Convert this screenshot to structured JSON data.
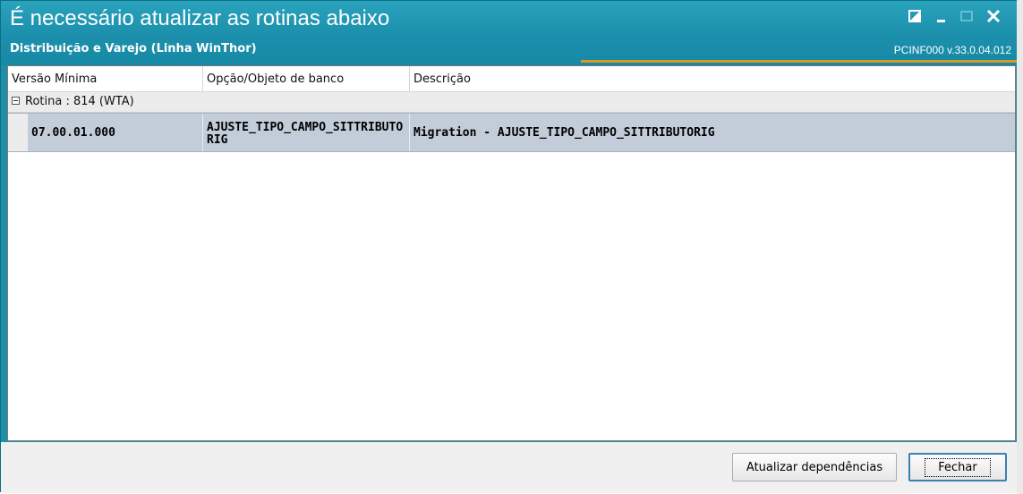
{
  "window": {
    "title": "É necessário atualizar as rotinas abaixo",
    "subtitle": "Distribuição e Varejo (Linha WinThor)",
    "version": "PCINF000  v.33.0.04.012",
    "accent": "#1b8fab",
    "underline_color": "#d49a2a"
  },
  "controls": {
    "restore_icon": "restore-icon",
    "minimize_icon": "minimize-icon",
    "maximize_icon": "maximize-icon",
    "close_icon": "close-icon"
  },
  "grid": {
    "columns": [
      "Versão Mínima",
      "Opção/Objeto de banco",
      "Descrição"
    ],
    "group_label": "Rotina : 814 (WTA)",
    "rows": [
      {
        "versao": "07.00.01.000",
        "objeto": "AJUSTE_TIPO_CAMPO_SITTRIBUTORIG",
        "descricao": "Migration - AJUSTE_TIPO_CAMPO_SITTRIBUTORIG"
      }
    ]
  },
  "buttons": {
    "atualizar": "Atualizar dependências",
    "fechar": "Fechar"
  }
}
